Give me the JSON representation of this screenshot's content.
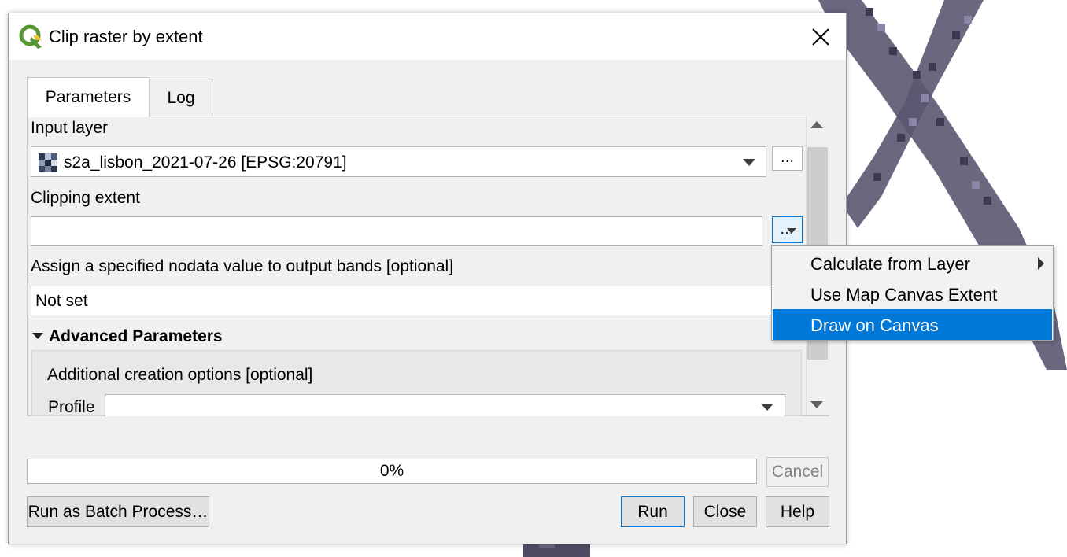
{
  "dialog": {
    "title": "Clip raster by extent"
  },
  "tabs": [
    {
      "label": "Parameters",
      "active": true
    },
    {
      "label": "Log",
      "active": false
    }
  ],
  "params": {
    "input_layer_label": "Input layer",
    "input_layer_value": "s2a_lisbon_2021-07-26 [EPSG:20791]",
    "input_layer_browse": "…",
    "clipping_extent_label": "Clipping extent",
    "clipping_extent_value": "",
    "clipping_extent_btn": "…",
    "nodata_label": "Assign a specified nodata value to output bands [optional]",
    "nodata_value": "Not set",
    "advanced_header": "Advanced Parameters",
    "creation_options_label": "Additional creation options [optional]",
    "profile_label": "Profile",
    "profile_value": ""
  },
  "progress": {
    "value_text": "0%",
    "fraction": 0
  },
  "buttons": {
    "cancel": "Cancel",
    "batch": "Run as Batch Process…",
    "run": "Run",
    "close": "Close",
    "help": "Help"
  },
  "context_menu": {
    "items": [
      {
        "label": "Calculate from Layer",
        "has_submenu": true,
        "selected": false
      },
      {
        "label": "Use Map Canvas Extent",
        "has_submenu": false,
        "selected": false
      },
      {
        "label": "Draw on Canvas",
        "has_submenu": false,
        "selected": true
      }
    ]
  },
  "colors": {
    "accent": "#0078d7",
    "qgis_green": "#589632",
    "qgis_yellow": "#f0c33c"
  },
  "icons": {
    "app": "qgis-logo-icon",
    "close": "close-icon",
    "raster": "raster-layer-icon",
    "dropdown": "chevron-down-icon",
    "scroll_up": "scroll-up-icon",
    "scroll_down": "scroll-down-icon",
    "collapse": "collapse-triangle-icon",
    "submenu": "submenu-arrow-icon"
  }
}
